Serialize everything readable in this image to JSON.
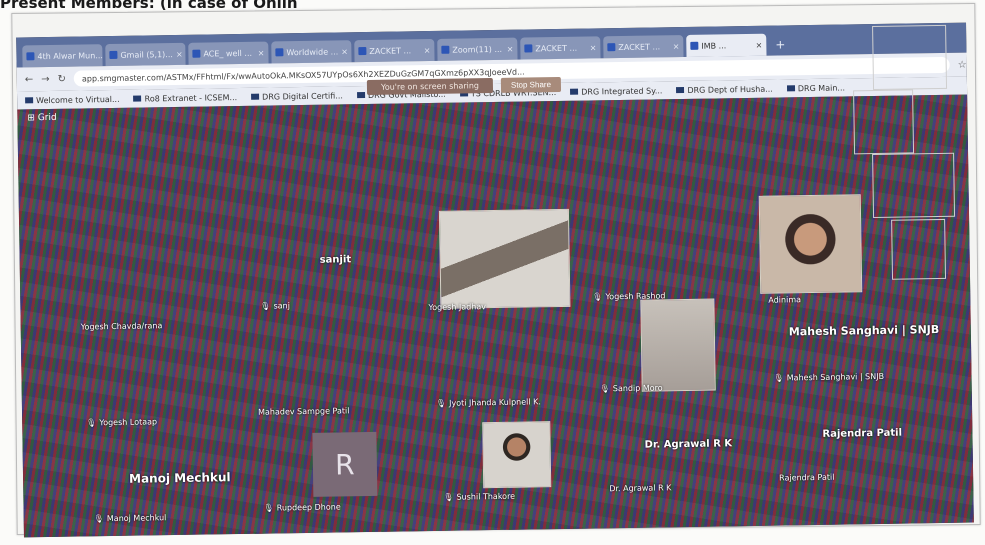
{
  "heading": "Present Members: (in case of Onlin",
  "browser": {
    "tabs": [
      {
        "label": "4th Alwar Mun...",
        "active": false
      },
      {
        "label": "Gmail (5,1)...",
        "active": false
      },
      {
        "label": "ACE_ well ...",
        "active": false
      },
      {
        "label": "Worldwide ...",
        "active": false
      },
      {
        "label": "ZACKET ...",
        "active": false
      },
      {
        "label": "Zoom(11) ...",
        "active": false
      },
      {
        "label": "ZACKET ...",
        "active": false
      },
      {
        "label": "ZACKET ...",
        "active": false
      },
      {
        "label": "IMB ...",
        "active": true
      }
    ],
    "new_tab": "+",
    "url": "app.smgmaster.com/ASTMx/FFhtml/Fx/wwAutoOkA.MKsOX57UYpOs6Xh2XEZDuGzGM7qGXmz6pXX3qJoeeVd...",
    "bookmarks": [
      "Welcome to Virtual...",
      "Ro8 Extranet - ICSEM...",
      "DRG Digital Certifi...",
      "DRG Govt Mailsto...",
      "TS CDRLB WRT.SEN...",
      "DRG Integrated Sy...",
      "DRG Dept of Husha...",
      "DRG Main..."
    ]
  },
  "meeting": {
    "share_message": "You're on screen sharing",
    "stop_share": "Stop Share",
    "view_label": "Grid",
    "participants": [
      {
        "name": "Yogesh Chavda/rana"
      },
      {
        "name": "sanj"
      },
      {
        "name": "sanjit"
      },
      {
        "name": "Yogesh Jadhav"
      },
      {
        "name": "Yogesh Rashod"
      },
      {
        "name": "Adinima"
      },
      {
        "name": "Sandip Moro"
      },
      {
        "name": "Mahesh Sanghavi | SNJB"
      },
      {
        "name": "Mahesh Sanghavi | SNJB"
      },
      {
        "name": "Yogesh Lotaap"
      },
      {
        "name": "Mahadev Sampge Patil"
      },
      {
        "name": "Jyoti Jhanda Kulpnell K."
      },
      {
        "name": "Manoj Mechkul"
      },
      {
        "name": "Manoj Mechkul"
      },
      {
        "name": "Rupdeep Dhone"
      },
      {
        "name": "Sushil Thakore"
      },
      {
        "name": "Dr. Agrawal R K"
      },
      {
        "name": "Dr. Agrawal R K"
      },
      {
        "name": "Rajendra Patil"
      },
      {
        "name": "Rajendra Patil"
      }
    ],
    "avatar_letter": "R"
  }
}
